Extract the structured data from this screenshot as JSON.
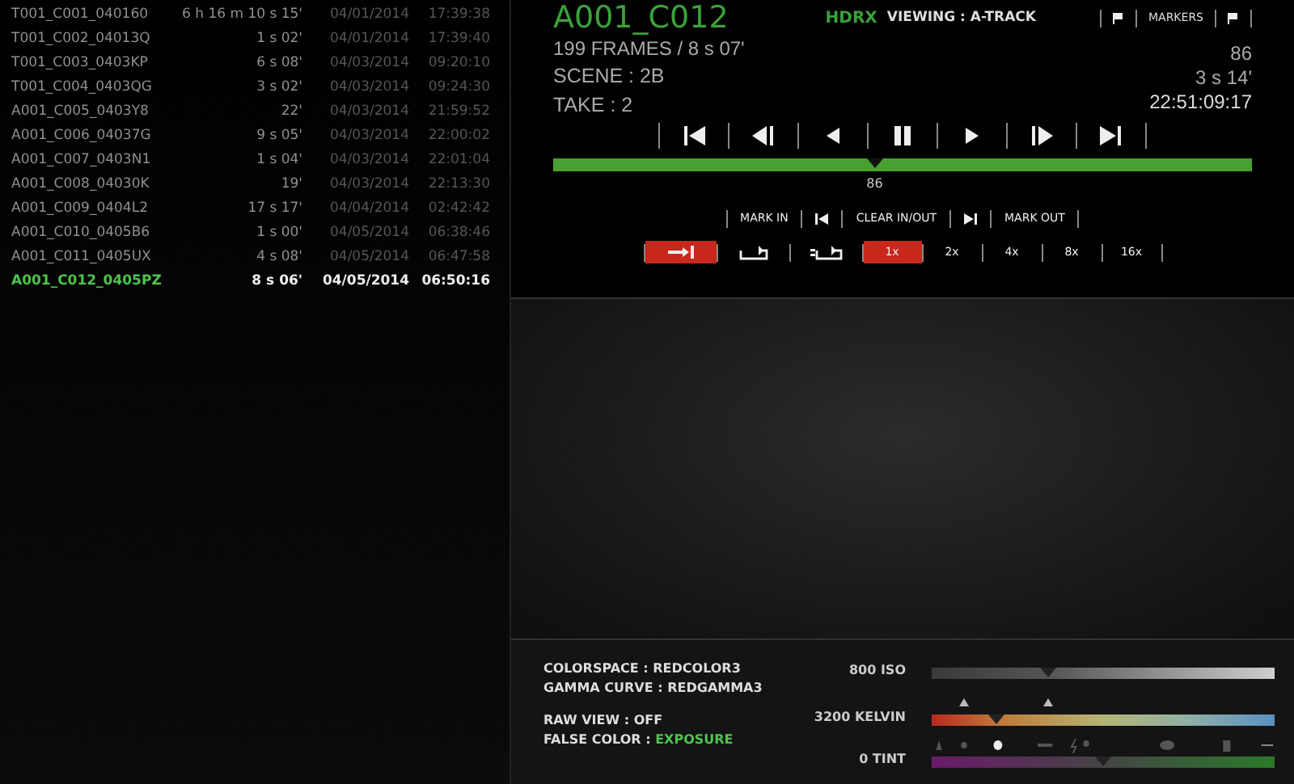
{
  "clips": [
    {
      "name": "T001_C001_040160",
      "duration": "6 h 16 m 10 s 15'",
      "date": "04/01/2014",
      "time": "17:39:38",
      "selected": false
    },
    {
      "name": "T001_C002_04013Q",
      "duration": "1 s 02'",
      "date": "04/01/2014",
      "time": "17:39:40",
      "selected": false
    },
    {
      "name": "T001_C003_0403KP",
      "duration": "6 s 08'",
      "date": "04/03/2014",
      "time": "09:20:10",
      "selected": false
    },
    {
      "name": "T001_C004_0403QG",
      "duration": "3 s 02'",
      "date": "04/03/2014",
      "time": "09:24:30",
      "selected": false
    },
    {
      "name": "A001_C005_0403Y8",
      "duration": "22'",
      "date": "04/03/2014",
      "time": "21:59:52",
      "selected": false
    },
    {
      "name": "A001_C006_04037G",
      "duration": "9 s 05'",
      "date": "04/03/2014",
      "time": "22:00:02",
      "selected": false
    },
    {
      "name": "A001_C007_0403N1",
      "duration": "1 s 04'",
      "date": "04/03/2014",
      "time": "22:01:04",
      "selected": false
    },
    {
      "name": "A001_C008_04030K",
      "duration": "19'",
      "date": "04/03/2014",
      "time": "22:13:30",
      "selected": false
    },
    {
      "name": "A001_C009_0404L2",
      "duration": "17 s 17'",
      "date": "04/04/2014",
      "time": "02:42:42",
      "selected": false
    },
    {
      "name": "A001_C010_0405B6",
      "duration": "1 s 00'",
      "date": "04/05/2014",
      "time": "06:38:46",
      "selected": false
    },
    {
      "name": "A001_C011_0405UX",
      "duration": "4 s 08'",
      "date": "04/05/2014",
      "time": "06:47:58",
      "selected": false
    },
    {
      "name": "A001_C012_0405PZ",
      "duration": "8 s 06'",
      "date": "04/05/2014",
      "time": "06:50:16",
      "selected": true
    }
  ],
  "clip": {
    "title": "A001_C012",
    "mode": "HDRX",
    "viewing": "VIEWING : A-TRACK",
    "markers_label": "MARKERS",
    "frames": "199 FRAMES / 8 s 07'",
    "scene": "SCENE : 2B",
    "take": "TAKE : 2",
    "frame": "86",
    "elapsed": "3 s 14'",
    "timecode": "22:51:09:17"
  },
  "playhead": {
    "level": 0.46,
    "label": "86"
  },
  "mark_controls": [
    {
      "kind": "text",
      "label": "MARK IN"
    },
    {
      "kind": "go-in"
    },
    {
      "kind": "text",
      "label": "CLEAR IN/OUT"
    },
    {
      "kind": "go-out"
    },
    {
      "kind": "text",
      "label": "MARK OUT"
    }
  ],
  "loop_modes": [
    {
      "kind": "play-to-out",
      "selected": true
    },
    {
      "kind": "loop",
      "selected": false
    },
    {
      "kind": "loop-range",
      "selected": false
    }
  ],
  "speeds": [
    {
      "label": "1x",
      "selected": true
    },
    {
      "label": "2x",
      "selected": false
    },
    {
      "label": "4x",
      "selected": false
    },
    {
      "label": "8x",
      "selected": false
    },
    {
      "label": "16x",
      "selected": false
    }
  ],
  "look": {
    "colorspace": "COLORSPACE : REDCOLOR3",
    "gamma": "GAMMA CURVE  : REDGAMMA3",
    "raw_view": "RAW VIEW : OFF",
    "false_color_label": "FALSE COLOR :",
    "false_color_value": "EXPOSURE"
  },
  "sliders": [
    {
      "kind": "iso",
      "label": "800 ISO",
      "level": 0.34
    },
    {
      "kind": "kelvin",
      "label": "3200 KELVIN",
      "level": 0.19
    },
    {
      "kind": "tint",
      "label": "0 TINT",
      "level": 0.5
    }
  ]
}
